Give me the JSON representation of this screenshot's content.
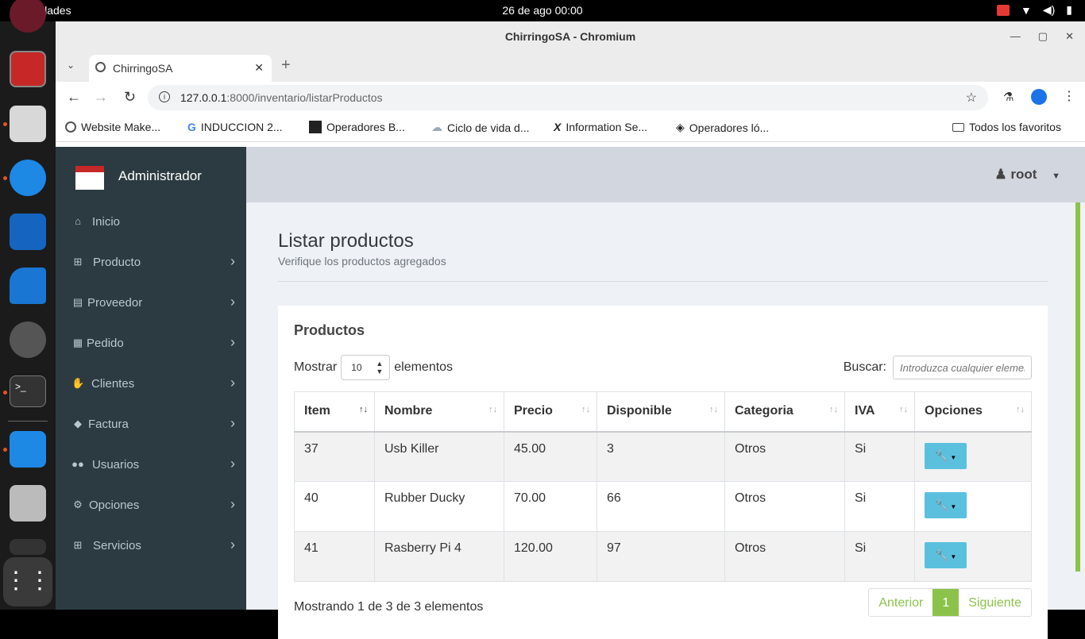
{
  "desktop": {
    "activities": "Actividades",
    "clock": "26 de ago  00:00"
  },
  "window": {
    "title": "ChirringoSA - Chromium"
  },
  "browser": {
    "tab_title": "ChirringoSA",
    "url_host": "127.0.0.1",
    "url_rest": ":8000/inventario/listarProductos",
    "bookmarks": [
      "Website Make...",
      "INDUCCION 2...",
      "Operadores B...",
      "Ciclo de vida d...",
      "Information Se...",
      "Operadores ló..."
    ],
    "all_bookmarks": "Todos los favoritos"
  },
  "sidebar": {
    "brand": "Administrador",
    "items": [
      {
        "label": "Inicio",
        "icon": "home-icon"
      },
      {
        "label": "Producto",
        "icon": "basket-icon"
      },
      {
        "label": "Proveedor",
        "icon": "book-icon"
      },
      {
        "label": "Pedido",
        "icon": "gift-icon"
      },
      {
        "label": "Clientes",
        "icon": "handshake-icon"
      },
      {
        "label": "Factura",
        "icon": "tag-icon"
      },
      {
        "label": "Usuarios",
        "icon": "users-icon"
      },
      {
        "label": "Opciones",
        "icon": "gear-icon"
      },
      {
        "label": "Servicios",
        "icon": "basket-icon"
      }
    ]
  },
  "header": {
    "user": "root"
  },
  "page": {
    "title": "Listar productos",
    "subtitle": "Verifique los productos agregados"
  },
  "card": {
    "title": "Productos",
    "show_label": "Mostrar",
    "show_value": "10",
    "elements_label": "elementos",
    "search_label": "Buscar:",
    "search_placeholder": "Introduzca cualquier elemento",
    "columns": [
      "Item",
      "Nombre",
      "Precio",
      "Disponible",
      "Categoria",
      "IVA",
      "Opciones"
    ],
    "rows": [
      [
        "37",
        "Usb Killer",
        "45.00",
        "3",
        "Otros",
        "Si"
      ],
      [
        "40",
        "Rubber Ducky",
        "70.00",
        "66",
        "Otros",
        "Si"
      ],
      [
        "41",
        "Rasberry Pi 4",
        "120.00",
        "97",
        "Otros",
        "Si"
      ]
    ],
    "info": "Mostrando 1 de 3 de 3 elementos",
    "pagination": {
      "prev": "Anterior",
      "page": "1",
      "next": "Siguiente"
    }
  },
  "colors": {
    "sidebar": "#2c3b41",
    "accent": "#5bc0de",
    "active_page": "#8bc34a"
  }
}
